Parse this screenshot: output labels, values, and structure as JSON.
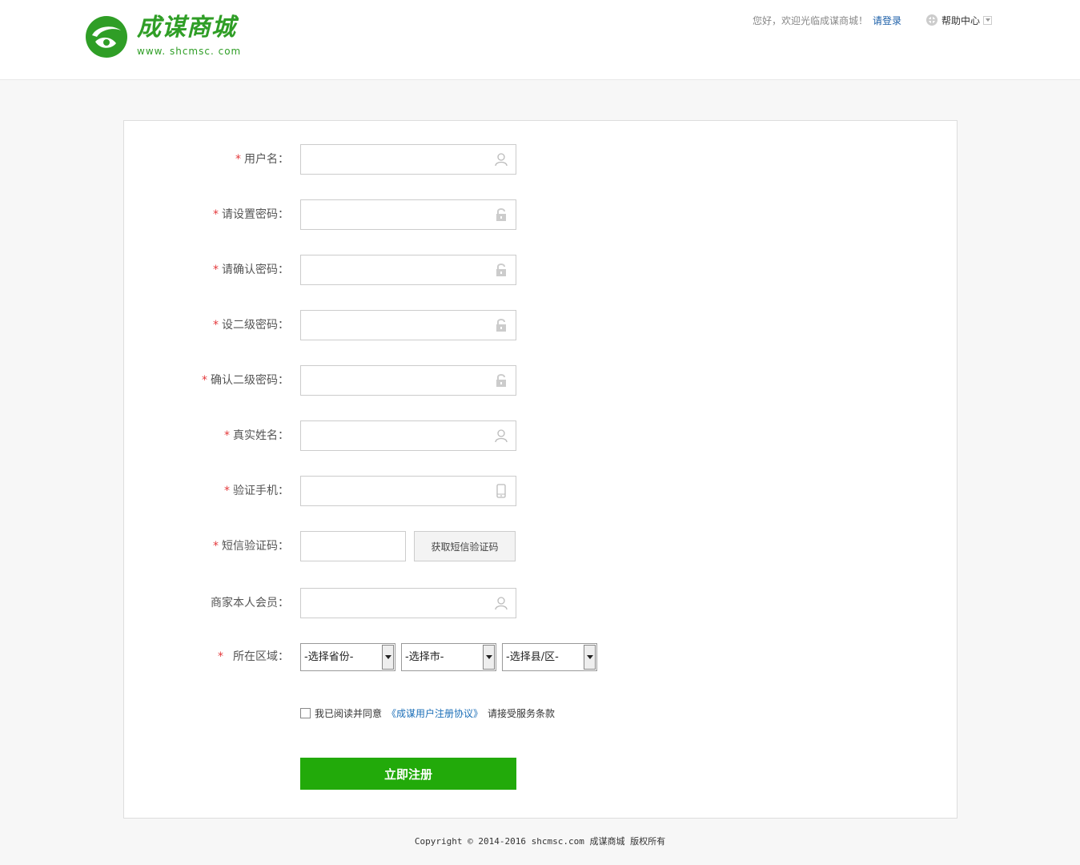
{
  "header": {
    "logo_text": "成谋商城",
    "logo_url": "www. shcmsc. com",
    "welcome": "您好，欢迎光临成谋商城！",
    "login_link": "请登录",
    "help_label": "帮助中心"
  },
  "form": {
    "fields": [
      {
        "label": "用户名：",
        "required": true,
        "icon": "user-icon"
      },
      {
        "label": "请设置密码：",
        "required": true,
        "icon": "lock-icon"
      },
      {
        "label": "请确认密码：",
        "required": true,
        "icon": "lock-icon"
      },
      {
        "label": "设二级密码：",
        "required": true,
        "icon": "lock-icon"
      },
      {
        "label": "确认二级密码：",
        "required": true,
        "icon": "lock-icon"
      },
      {
        "label": "真实姓名：",
        "required": true,
        "icon": "user-icon"
      },
      {
        "label": "验证手机：",
        "required": true,
        "icon": "phone-icon"
      }
    ],
    "sms": {
      "label": "短信验证码：",
      "required": true,
      "button": "获取短信验证码"
    },
    "referrer": {
      "label": "商家本人会员：",
      "required": false,
      "icon": "user-icon"
    },
    "region": {
      "label": "所在区域：",
      "required": true,
      "province": "-选择省份-",
      "city": "-选择市-",
      "county": "-选择县/区-"
    },
    "agreement": {
      "prefix": "我已阅读并同意",
      "link": "《成谋用户注册协议》",
      "suffix": "请接受服务条款"
    },
    "submit": "立即注册",
    "required_mark": "*"
  },
  "footer": {
    "copyright": "Copyright © 2014-2016 shcmsc.com 成谋商城 版权所有"
  },
  "colors": {
    "brand": "#2f9e26",
    "button": "#22aa0a",
    "required": "#e4393c",
    "link": "#1c6fb8"
  }
}
